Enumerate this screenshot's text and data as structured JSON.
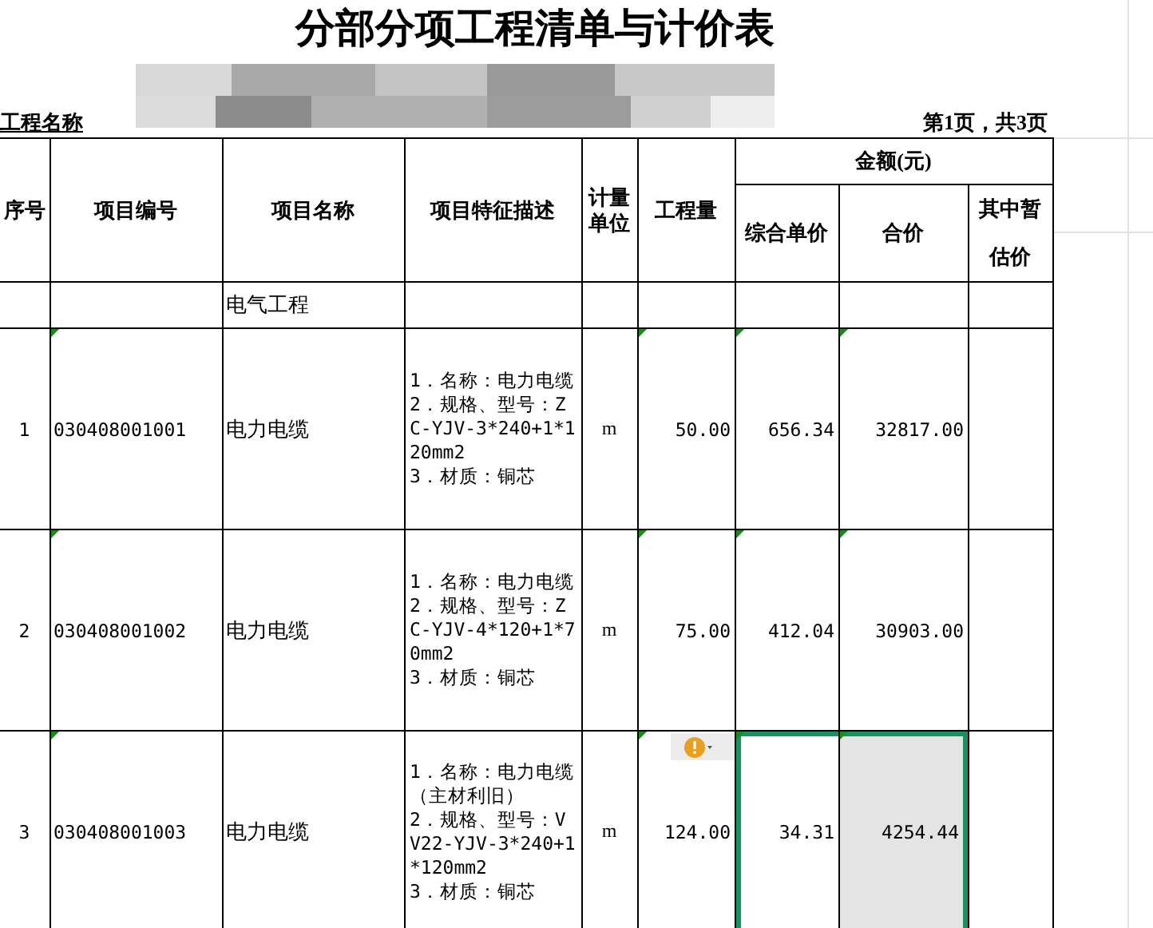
{
  "title": "分部分项工程清单与计价表",
  "project_label": "工程名称",
  "page_info": "第1页，共3页",
  "columns": {
    "seq": "序号",
    "code": "项目编号",
    "name": "项目名称",
    "desc": "项目特征描述",
    "unit": "计量单位",
    "qty": "工程量",
    "amount": "金额(元)",
    "unit_price": "综合单价",
    "total": "合价",
    "provisional": "其中暂估价"
  },
  "section": "电气工程",
  "rows": [
    {
      "seq": "1",
      "code": "030408001001",
      "name": "电力电缆",
      "desc": "1．名称：电力电缆\n2．规格、型号：ZC-YJV-3*240+1*120mm2\n3．材质：铜芯",
      "unit": "m",
      "qty": "50.00",
      "unit_price": {
        "value": "656.34",
        "selected": false
      },
      "total": {
        "value": "32817.00",
        "selected": false
      },
      "flagged": true,
      "warning": false
    },
    {
      "seq": "2",
      "code": "030408001002",
      "name": "电力电缆",
      "desc": "1．名称：电力电缆\n2．规格、型号：ZC-YJV-4*120+1*70mm2\n3．材质：铜芯",
      "unit": "m",
      "qty": "75.00",
      "unit_price": {
        "value": "412.04",
        "selected": false
      },
      "total": {
        "value": "30903.00",
        "selected": false
      },
      "flagged": true,
      "warning": false
    },
    {
      "seq": "3",
      "code": "030408001003",
      "name": "电力电缆",
      "desc": "1．名称：电力电缆（主材利旧）\n2．规格、型号：VV22-YJV-3*240+1*120mm2\n3．材质：铜芯",
      "unit": "m",
      "qty": "124.00",
      "unit_price": {
        "value": "34.31",
        "selected": true
      },
      "total": {
        "value": "4254.44",
        "selected": true
      },
      "flagged": true,
      "warning": true
    }
  ]
}
